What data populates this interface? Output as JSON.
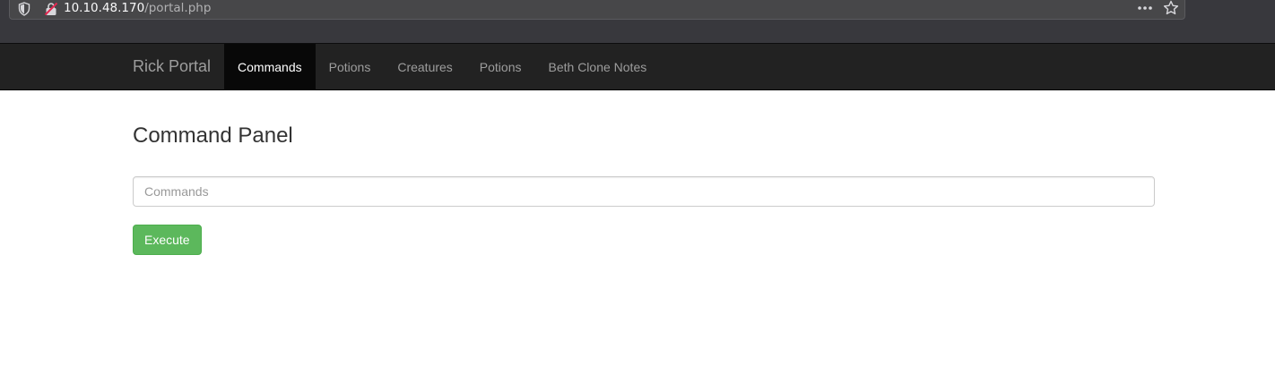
{
  "browser": {
    "url_host": "10.10.48.170",
    "url_path": "/portal.php",
    "icons": {
      "tracking": "shield-icon",
      "security": "insecure-lock-icon",
      "page_actions": "more-horizontal-icon",
      "bookmark": "star-icon"
    }
  },
  "navbar": {
    "brand": "Rick Portal",
    "items": [
      {
        "label": "Commands",
        "active": true
      },
      {
        "label": "Potions",
        "active": false
      },
      {
        "label": "Creatures",
        "active": false
      },
      {
        "label": "Potions",
        "active": false
      },
      {
        "label": "Beth Clone Notes",
        "active": false
      }
    ]
  },
  "main": {
    "title": "Command Panel",
    "command_input": {
      "value": "",
      "placeholder": "Commands"
    },
    "execute_label": "Execute"
  },
  "colors": {
    "navbar_bg": "#222222",
    "navbar_active_bg": "#080808",
    "button_success": "#5cb85c",
    "browser_chrome": "#38383d"
  }
}
